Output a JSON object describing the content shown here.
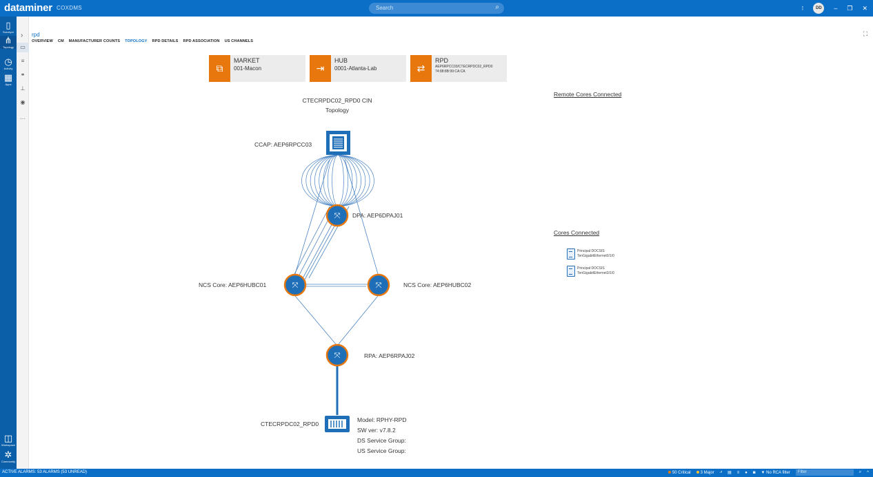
{
  "app": {
    "name": "dataminer",
    "subtitle": "COXDMS",
    "user_initials": "DD"
  },
  "search": {
    "placeholder": "Search"
  },
  "leftnav": {
    "items": [
      {
        "label": "Surveyor"
      },
      {
        "label": "Topology"
      },
      {
        "label": "Activity"
      },
      {
        "label": "Apps"
      },
      {
        "label": "Workspace"
      },
      {
        "label": "Community"
      }
    ]
  },
  "breadcrumb": {
    "current": "rpd"
  },
  "tabs": [
    {
      "label": "OVERVIEW"
    },
    {
      "label": "CM"
    },
    {
      "label": "MANUFACTURER COUNTS"
    },
    {
      "label": "TOPOLOGY",
      "active": true
    },
    {
      "label": "RPD DETAILS"
    },
    {
      "label": "RPD ASSOCIATION"
    },
    {
      "label": "US CHANNELS"
    }
  ],
  "cards": {
    "market": {
      "title": "MARKET",
      "value": "001-Macon"
    },
    "hub": {
      "title": "HUB",
      "value": "0001-Atlanta-Lab"
    },
    "rpd": {
      "title": "RPD",
      "line1": "AEP6RPCC03/CTECRPDC02_RPD0",
      "line2": "74:88:8B:99:CA:CA"
    }
  },
  "topology": {
    "title_line1": "CTECRPDC02_RPD0 CIN",
    "title_line2": "Topology",
    "ccap": "CCAP: AEP6RPCC03",
    "dpa": "DPA: AEP6DPAJ01",
    "ncs1": "NCS Core: AEP6HUBC01",
    "ncs2": "NCS Core: AEP6HUBC02",
    "rpa": "RPA: AEP6RPAJ02",
    "rpd_name": "CTECRPDC02_RPD0",
    "model": "Model: RPHY-RPD",
    "sw": "SW ver: v7.8.2",
    "ds": "DS Service Group:",
    "us": "US Service Group:"
  },
  "side": {
    "remote_cores": "Remote Cores Connected",
    "cores_connected": "Cores Connected",
    "cores": [
      {
        "line1": "Principal:DOCSIS",
        "line2": "TenGigabitEthernet0/1/0"
      },
      {
        "line1": "Principal:DOCSIS",
        "line2": "TenGigabitEthernet3/1/0"
      }
    ]
  },
  "status": {
    "alarms": "ACTIVE ALARMS: 53 ALARMS (53 UNREAD)",
    "critical": "50 Critical",
    "major": "3 Major",
    "rca": "No RCA filter",
    "filter_placeholder": "Filter"
  },
  "colors": {
    "brand": "#0b6fc7",
    "accent": "#e8780e",
    "node": "#1f6fb8"
  }
}
